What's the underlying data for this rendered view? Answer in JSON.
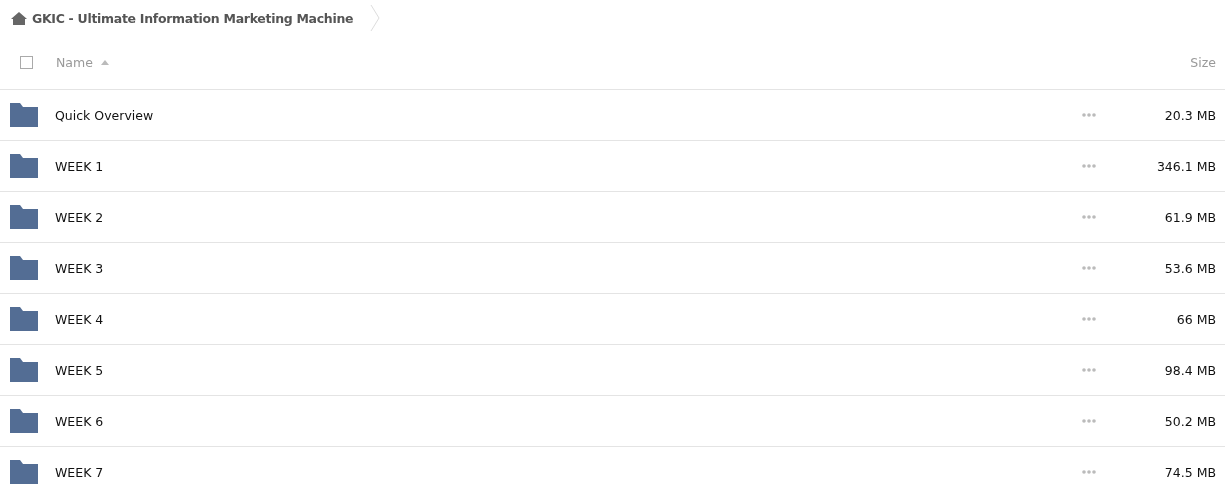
{
  "breadcrumb": {
    "title": "GKIC - Ultimate Information Marketing Machine"
  },
  "header": {
    "select_all": {
      "checked": false
    },
    "name": "Name",
    "sort_ascending": true,
    "size": "Size"
  },
  "rows": [
    {
      "name": "Quick Overview",
      "size": "20.3 MB"
    },
    {
      "name": "WEEK 1",
      "size": "346.1 MB"
    },
    {
      "name": "WEEK 2",
      "size": "61.9 MB"
    },
    {
      "name": "WEEK 3",
      "size": "53.6 MB"
    },
    {
      "name": "WEEK 4",
      "size": "66 MB"
    },
    {
      "name": "WEEK 5",
      "size": "98.4 MB"
    },
    {
      "name": "WEEK 6",
      "size": "50.2 MB"
    },
    {
      "name": "WEEK 7",
      "size": "74.5 MB"
    }
  ]
}
